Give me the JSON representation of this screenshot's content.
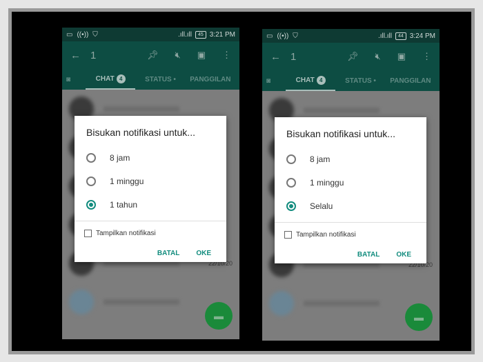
{
  "phones": [
    {
      "status": {
        "time": "3:21 PM",
        "battery": "45"
      },
      "toolbar": {
        "count": "1"
      },
      "tabs": {
        "chat": "CHAT",
        "chat_badge": "4",
        "status": "STATUS •",
        "calls": "PANGGILAN"
      },
      "list_date": "22/10/20",
      "dialog": {
        "title": "Bisukan notifikasi untuk...",
        "options": [
          "8 jam",
          "1 minggu",
          "1 tahun"
        ],
        "selected": 2,
        "checkbox": "Tampilkan notifikasi",
        "cancel": "BATAL",
        "ok": "OKE"
      }
    },
    {
      "status": {
        "time": "3:24 PM",
        "battery": "44"
      },
      "toolbar": {
        "count": "1"
      },
      "tabs": {
        "chat": "CHAT",
        "chat_badge": "4",
        "status": "STATUS •",
        "calls": "PANGGILAN"
      },
      "list_date": "22/10/20",
      "dialog": {
        "title": "Bisukan notifikasi untuk...",
        "options": [
          "8 jam",
          "1 minggu",
          "Selalu"
        ],
        "selected": 2,
        "checkbox": "Tampilkan notifikasi",
        "cancel": "BATAL",
        "ok": "OKE"
      }
    }
  ],
  "colors": {
    "accent": "#128c7e",
    "toolbar": "#0d4d43",
    "fab": "#1a8a3a"
  }
}
